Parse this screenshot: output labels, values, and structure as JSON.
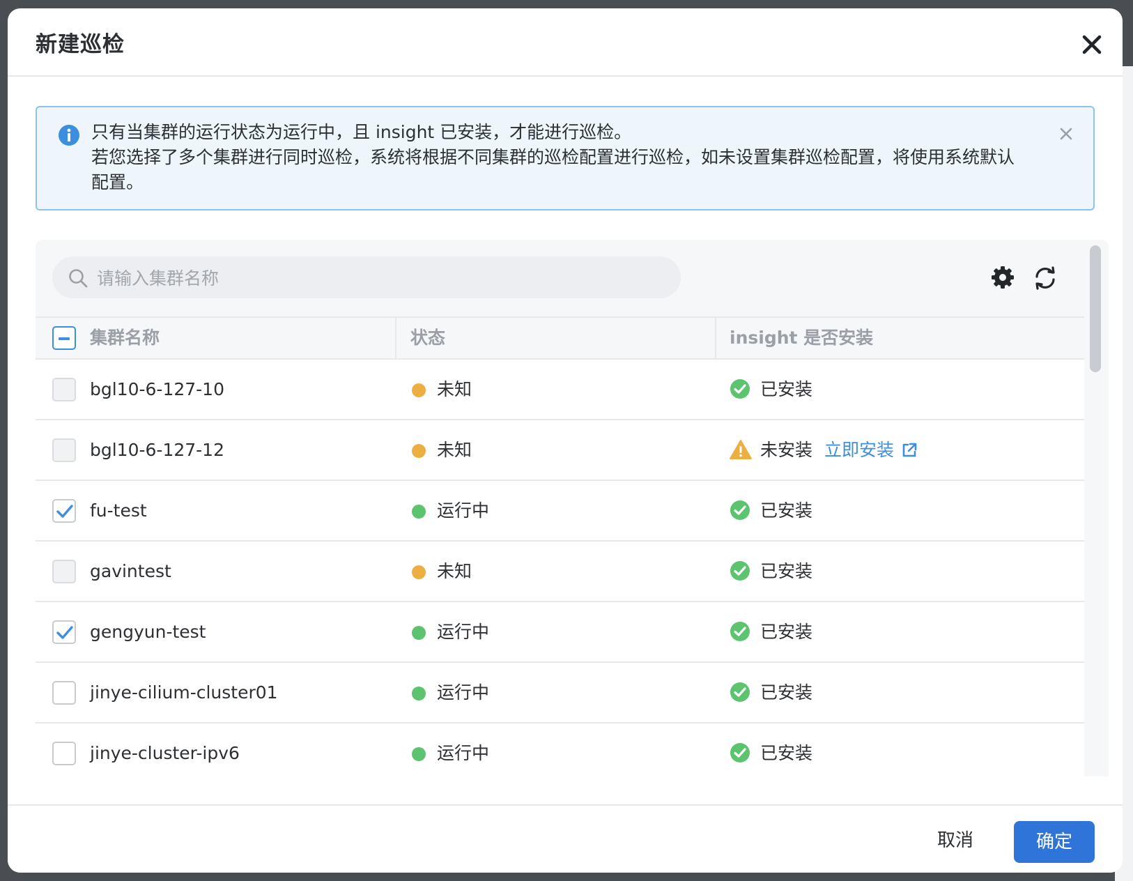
{
  "dialog": {
    "title": "新建巡检",
    "cancel_label": "取消",
    "confirm_label": "确定",
    "primary_color": "#2f74d9"
  },
  "alert": {
    "line1": "只有当集群的运行状态为运行中，且 insight 已安装，才能进行巡检。",
    "line2": "若您选择了多个集群进行同时巡检，系统将根据不同集群的巡检配置进行巡检，如未设置集群巡检配置，将使用系统默认配置。",
    "icon": "info-icon"
  },
  "search": {
    "placeholder": "请输入集群名称",
    "value": ""
  },
  "table": {
    "columns": [
      "集群名称",
      "状态",
      "insight 是否安装"
    ],
    "rows": [
      {
        "name": "bgl10-6-127-10",
        "status": "未知",
        "status_color": "#ecb042",
        "insight": "已安装",
        "installed": true,
        "selectable": false,
        "checked": false
      },
      {
        "name": "bgl10-6-127-12",
        "status": "未知",
        "status_color": "#ecb042",
        "insight": "未安装",
        "installed": false,
        "install_link": "立即安装",
        "selectable": false,
        "checked": false
      },
      {
        "name": "fu-test",
        "status": "运行中",
        "status_color": "#5cc36f",
        "insight": "已安装",
        "installed": true,
        "selectable": true,
        "checked": true
      },
      {
        "name": "gavintest",
        "status": "未知",
        "status_color": "#ecb042",
        "insight": "已安装",
        "installed": true,
        "selectable": false,
        "checked": false
      },
      {
        "name": "gengyun-test",
        "status": "运行中",
        "status_color": "#5cc36f",
        "insight": "已安装",
        "installed": true,
        "selectable": true,
        "checked": true
      },
      {
        "name": "jinye-cilium-cluster01",
        "status": "运行中",
        "status_color": "#5cc36f",
        "insight": "已安装",
        "installed": true,
        "selectable": true,
        "checked": false
      },
      {
        "name": "jinye-cluster-ipv6",
        "status": "运行中",
        "status_color": "#5cc36f",
        "insight": "已安装",
        "installed": true,
        "selectable": true,
        "checked": false
      }
    ]
  }
}
